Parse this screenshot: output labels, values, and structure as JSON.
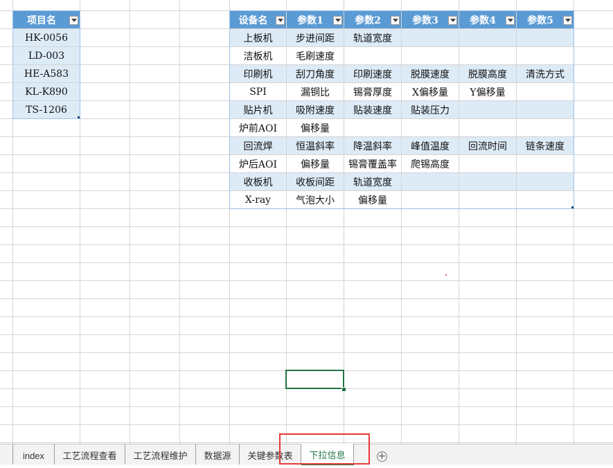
{
  "left_table": {
    "header": "项目名",
    "rows": [
      "HK-0056",
      "LD-003",
      "HE-A583",
      "KL-K890",
      "TS-1206"
    ]
  },
  "main_table": {
    "headers": [
      "设备名",
      "参数1",
      "参数2",
      "参数3",
      "参数4",
      "参数5"
    ],
    "rows": [
      [
        "上板机",
        "步进间距",
        "轨道宽度",
        "",
        "",
        ""
      ],
      [
        "洁板机",
        "毛刷速度",
        "",
        "",
        "",
        ""
      ],
      [
        "印刷机",
        "刮刀角度",
        "印刷速度",
        "脱膜速度",
        "脱膜高度",
        "清洗方式"
      ],
      [
        "SPI",
        "漏铜比",
        "锡膏厚度",
        "X偏移量",
        "Y偏移量",
        ""
      ],
      [
        "贴片机",
        "吸附速度",
        "贴装速度",
        "贴装压力",
        "",
        ""
      ],
      [
        "炉前AOI",
        "偏移量",
        "",
        "",
        "",
        ""
      ],
      [
        "回流焊",
        "恒温斜率",
        "降温斜率",
        "峰值温度",
        "回流时间",
        "链条速度"
      ],
      [
        "炉后AOI",
        "偏移量",
        "锡膏覆盖率",
        "爬锡高度",
        "",
        ""
      ],
      [
        "收板机",
        "收板间距",
        "轨道宽度",
        "",
        "",
        ""
      ],
      [
        "X-ray",
        "气泡大小",
        "偏移量",
        "",
        "",
        ""
      ]
    ]
  },
  "sheet_tabs": {
    "items": [
      "index",
      "工艺流程查看",
      "工艺流程维护",
      "数据源",
      "关键参数表",
      "下拉信息"
    ],
    "active": "下拉信息",
    "add_icon": "+"
  },
  "colors": {
    "header_fill": "#5b9bd5",
    "band_fill": "#ddebf7",
    "selection": "#217346",
    "highlight_box": "#e53935"
  },
  "icons": {
    "filter": "chevron-down-icon",
    "add_sheet": "plus-circle-icon"
  }
}
